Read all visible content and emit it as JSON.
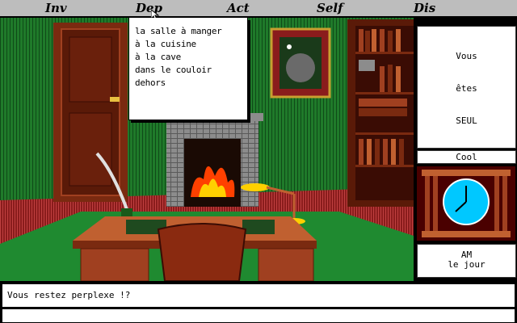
{
  "menu": {
    "inv": "Inv",
    "dep": "Dep",
    "act": "Act",
    "self": "Self",
    "dis": "Dis"
  },
  "dropdown": {
    "items": [
      "la salle à manger",
      "à la cuisine",
      "à la cave",
      "dans le couloir",
      "dehors"
    ]
  },
  "status": {
    "line1": "Vous",
    "line2": "êtes",
    "line3": "SEUL",
    "mood": "Cool",
    "period": "AM",
    "daytime": "le jour"
  },
  "message": "Vous restez perplexe !?",
  "colors": {
    "menubar": "#bdbdbd",
    "wall": "#1f7a2a",
    "floor": "#8a1c1c",
    "wood": "#7a2a10",
    "clock_face": "#00c8ff"
  },
  "icons": [
    "mouse-cursor-icon",
    "clock-icon"
  ]
}
